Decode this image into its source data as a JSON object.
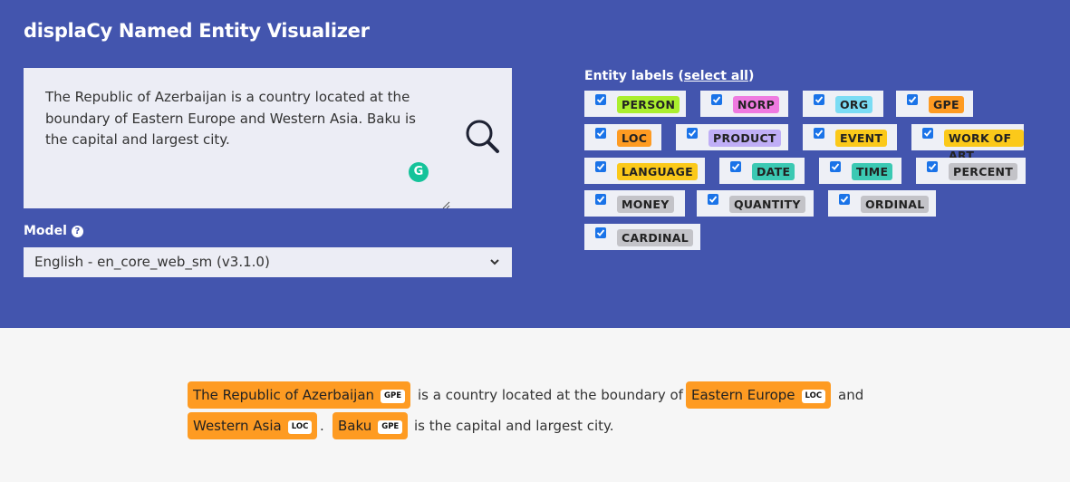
{
  "header": {
    "title": "displaCy Named Entity Visualizer"
  },
  "input": {
    "text": "The Republic of Azerbaijan is a country located at the boundary of Eastern Europe and Western Asia. Baku is the capital and largest city.",
    "grammarly_badge": "G"
  },
  "model": {
    "label": "Model",
    "help_icon": "?",
    "selected": "English - en_core_web_sm (v3.1.0)"
  },
  "entity_labels": {
    "heading": "Entity labels (",
    "select_all": "select all",
    "heading_close": ")",
    "items": [
      {
        "label": "PERSON",
        "color": "#aaee2e",
        "checked": true
      },
      {
        "label": "NORP",
        "color": "#ee7ae0",
        "checked": true
      },
      {
        "label": "ORG",
        "color": "#7bdcf4",
        "checked": true
      },
      {
        "label": "GPE",
        "color": "#fe9b22",
        "checked": true
      },
      {
        "label": "LOC",
        "color": "#fe9b22",
        "checked": true
      },
      {
        "label": "PRODUCT",
        "color": "#bfaef6",
        "checked": true
      },
      {
        "label": "EVENT",
        "color": "#fbc91a",
        "checked": true
      },
      {
        "label": "WORK OF ART",
        "color": "#fbc91a",
        "checked": true
      },
      {
        "label": "LANGUAGE",
        "color": "#fbc91a",
        "checked": true
      },
      {
        "label": "DATE",
        "color": "#3bc9b3",
        "checked": true
      },
      {
        "label": "TIME",
        "color": "#3bc9b3",
        "checked": true
      },
      {
        "label": "PERCENT",
        "color": "#c3c3c8",
        "checked": true
      },
      {
        "label": "MONEY",
        "color": "#c3c3c8",
        "checked": true
      },
      {
        "label": "QUANTITY",
        "color": "#c3c3c8",
        "checked": true
      },
      {
        "label": "ORDINAL",
        "color": "#c3c3c8",
        "checked": true
      },
      {
        "label": "CARDINAL",
        "color": "#c3c3c8",
        "checked": true
      }
    ]
  },
  "result": {
    "ent1": {
      "text": "The Republic of Azerbaijan",
      "label": "GPE"
    },
    "t1": "is a country located at the boundary of",
    "ent2": {
      "text": "Eastern Europe",
      "label": "LOC"
    },
    "t2": "and",
    "ent3": {
      "text": "Western Asia",
      "label": "LOC"
    },
    "t3": ".",
    "ent4": {
      "text": "Baku",
      "label": "GPE"
    },
    "t4": "is the capital and largest city."
  }
}
